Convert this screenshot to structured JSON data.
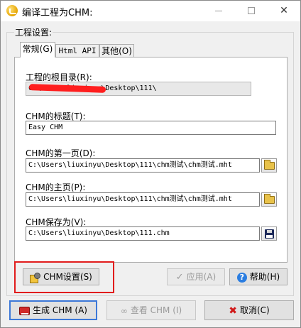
{
  "window": {
    "title": "编译工程为CHM:"
  },
  "titlebar": {
    "minimize": "—",
    "maximize": "□",
    "close": "✕"
  },
  "group": {
    "label": "工程设置:"
  },
  "tabs": [
    {
      "label": "常规(G)"
    },
    {
      "label": "Html API"
    },
    {
      "label": "其他(O)"
    }
  ],
  "fields": {
    "project_root": {
      "label": "工程的根目录(R):",
      "value": "C:\\Users\\liuxinyu\\Desktop\\111\\"
    },
    "chm_title": {
      "label": "CHM的标题(T):",
      "value": "Easy CHM"
    },
    "first_page": {
      "label": "CHM的第一页(D):",
      "value": "C:\\Users\\liuxinyu\\Desktop\\111\\chm测试\\chm测试.mht"
    },
    "home_page": {
      "label": "CHM的主页(P):",
      "value": "C:\\Users\\liuxinyu\\Desktop\\111\\chm测试\\chm测试.mht"
    },
    "save_as": {
      "label": "CHM保存为(V):",
      "value": "C:\\Users\\liuxinyu\\Desktop\\111.chm"
    }
  },
  "buttons": {
    "chm_settings": "CHM设置(S)",
    "apply": "应用(A)",
    "help": "帮助(H)",
    "build": "生成 CHM (A)",
    "view": "查看 CHM (I)",
    "cancel": "取消(C)"
  },
  "icons": {
    "app": "easy-chm-app-icon",
    "browse": "folder-open-icon",
    "save": "floppy-disk-icon",
    "settings": "settings-icon",
    "apply": "checkmark-icon",
    "help": "question-mark-icon",
    "build": "book-icon",
    "view": "glasses-icon",
    "cancel": "red-x-icon"
  },
  "colors": {
    "highlight": "#e11c1c",
    "redaction": "#ff1e1e",
    "accent": "#3c78d8"
  }
}
